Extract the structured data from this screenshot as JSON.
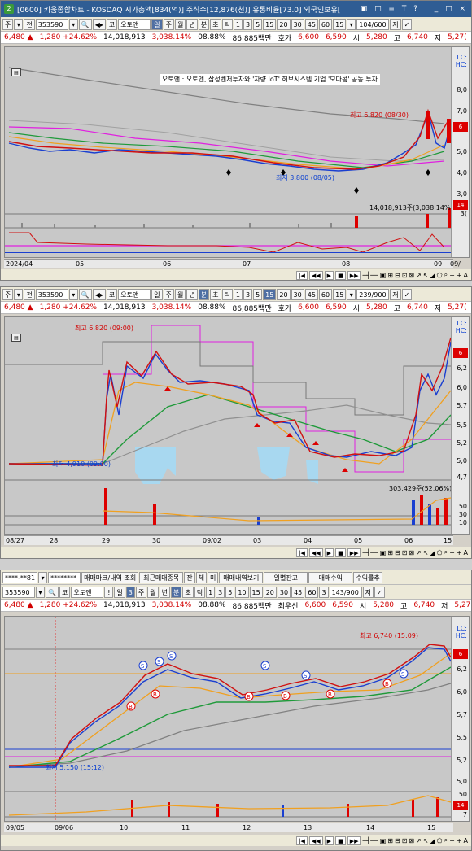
{
  "window1": {
    "title": "[0600] 키움종합차트 - KOSDAQ 시가총액[834(억)] 주식수[12,876(천)] 유통비율[73.0] 외국인보유[",
    "ctrls": "▣ □ ≡ T ? | _ □ ×",
    "toolbar": {
      "period": "주",
      "prev": "전",
      "code": "353590",
      "search": "🔍",
      "sound": "◀▸",
      "market": "코",
      "name": "오토앤",
      "periods": [
        "일",
        "주",
        "월",
        "년",
        "분",
        "초",
        "틱",
        "1",
        "3",
        "5",
        "15",
        "20",
        "30",
        "45",
        "60"
      ],
      "active_period": "일",
      "selected_min": "15",
      "count": "104/600",
      "save": "저",
      "extra": "✓"
    },
    "info": {
      "price": "6,480 ▲",
      "change": "1,280 +24.62%",
      "volume": "14,018,913",
      "vol_ratio": "3,038.14%",
      "turnover": "08.88%",
      "amount": "86,885백만",
      "label_quote": "호가",
      "quote": "6,600",
      "bid": "6,590",
      "open_lbl": "시",
      "open": "5,280",
      "high_lbl": "고",
      "high": "6,740",
      "close_lbl": "저",
      "low": "5,27("
    },
    "news": "오토앤 : 오토앤, 삼성벤처투자와 '차량 IoT' 허브시스템 기업 '모다콤' 공동 투자",
    "high_label": "최고 6,820 (08/30)",
    "low_label": "최저 3,800 (08/05)",
    "vol_label": "14,018,913주(3,038.14%)",
    "lc": "LC:",
    "hc": "HC:",
    "yticks": [
      "8,0",
      "7,0",
      "6",
      "5,0",
      "4,0",
      "3,0"
    ],
    "vol_ticks": [
      "14",
      "3("
    ],
    "xticks": [
      "2024/04",
      "05",
      "06",
      "07",
      "08",
      "09",
      "09/"
    ],
    "footer": [
      "|◀",
      "◀◀",
      "▶",
      "■",
      "▶▶",
      "─┤──",
      "▣",
      "⊞",
      "⊟",
      "⊡",
      "⊠",
      "↗",
      "↖",
      "◢",
      "⬠",
      "⌕",
      "−",
      "+",
      "A"
    ]
  },
  "window2": {
    "toolbar": {
      "period": "주",
      "prev": "전",
      "code": "353590",
      "search": "🔍",
      "sound": "◀▸",
      "market": "코",
      "name": "오토앤",
      "periods": [
        "일",
        "주",
        "월",
        "년",
        "분",
        "초",
        "틱",
        "1",
        "3",
        "5",
        "15",
        "20",
        "30",
        "45",
        "60"
      ],
      "active_period": "15",
      "selected_min": "15",
      "count": "239/900",
      "save": "저",
      "extra": "✓"
    },
    "info": {
      "price": "6,480 ▲",
      "change": "1,280 +24.62%",
      "volume": "14,018,913",
      "vol_ratio": "3,038.14%",
      "turnover": "08.88%",
      "amount": "86,885백만",
      "label_quote": "호가",
      "quote": "6,600",
      "bid": "6,590",
      "open_lbl": "시",
      "open": "5,280",
      "high_lbl": "고",
      "high": "6,740",
      "close_lbl": "저",
      "low": "5,27("
    },
    "high_label": "최고 6,820 (09:00)",
    "low_label": "최저 4,910 (09:00)",
    "vol_label": "303,429주(52,06%)",
    "lc": "LC:",
    "hc": "HC:",
    "yticks": [
      "6",
      "6,2",
      "6,0",
      "5,7",
      "5,5",
      "5,2",
      "5,0",
      "4,7"
    ],
    "vol_ticks": [
      "50",
      "30",
      "10"
    ],
    "xticks": [
      "08/27",
      "28",
      "29",
      "30",
      "09/02",
      "03",
      "04",
      "05",
      "06",
      "15"
    ],
    "footer": [
      "|◀",
      "◀◀",
      "▶",
      "■",
      "▶▶",
      "─┤──",
      "▣",
      "⊞",
      "⊟",
      "⊡",
      "⊠",
      "↗",
      "↖",
      "◢",
      "⬠",
      "⌕",
      "−",
      "+",
      "A"
    ]
  },
  "window3": {
    "toolbar_top": {
      "account": "****-**81",
      "password": "********",
      "btn1": "매매마크/내역 조회",
      "btn2": "최근매매종목",
      "btn3": "잔",
      "btn4": "체",
      "btn5": "미",
      "btn6": "매매내역보기",
      "btn7": "일별잔고",
      "btn8": "매매수익",
      "btn9": "수익률추"
    },
    "toolbar": {
      "code": "353590",
      "search": "🔍",
      "market": "코",
      "name": "오토앤",
      "mark": "!",
      "day": "일",
      "three": "3",
      "periods": [
        "주",
        "월",
        "년",
        "분",
        "초",
        "틱",
        "1",
        "3",
        "5",
        "10",
        "15",
        "20",
        "30",
        "45",
        "60"
      ],
      "active_period": "분",
      "selected_min": "3",
      "count": "143/900",
      "save": "저",
      "extra": "✓"
    },
    "info": {
      "price": "6,480 ▲",
      "change": "1,280 +24.62%",
      "volume": "14,018,913",
      "vol_ratio": "3,038.14%",
      "turnover": "08.88%",
      "amount": "86,885백만",
      "label_quote": "최우선",
      "quote": "6,600",
      "bid": "6,590",
      "open_lbl": "시",
      "open": "5,280",
      "high_lbl": "고",
      "high": "6,740",
      "close_lbl": "저",
      "low": "5,27("
    },
    "high_label": "최고 6,740 (15:09)",
    "low_label": "최저 5,150 (15:12)",
    "lc": "LC:",
    "hc": "HC:",
    "yticks": [
      "6",
      "6,2",
      "6,0",
      "5,7",
      "5,5",
      "5,2",
      "5,0"
    ],
    "vol_ticks": [
      "50",
      "14",
      "7"
    ],
    "xticks": [
      "09/05",
      "09/06",
      "10",
      "11",
      "12",
      "13",
      "14",
      "15"
    ],
    "footer": [
      "|◀",
      "◀◀",
      "▶",
      "■",
      "▶▶",
      "─┤──",
      "▣",
      "⊞",
      "⊟",
      "⊡",
      "⊠",
      "↗",
      "↖",
      "◢",
      "⬠",
      "⌕",
      "−",
      "+",
      "A"
    ]
  }
}
